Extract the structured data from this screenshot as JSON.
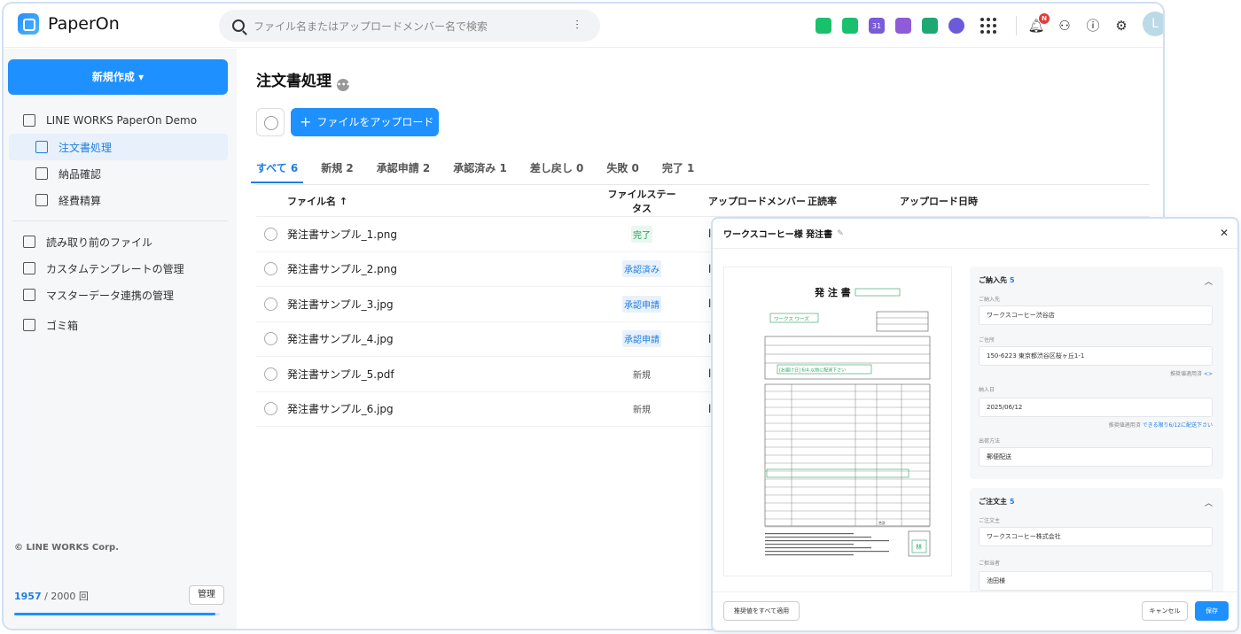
{
  "app": {
    "name": "PaperOn",
    "avatar_letter": "L"
  },
  "search": {
    "placeholder": "ファイル名またはアップロードメンバー名で検索"
  },
  "header_apps": [
    {
      "icon": "message-icon",
      "color": "#19c16c"
    },
    {
      "icon": "mail-icon",
      "color": "#19c16c"
    },
    {
      "icon": "calendar-icon",
      "color": "#7a5bd8"
    },
    {
      "icon": "note-icon",
      "color": "#8f5bd8"
    },
    {
      "icon": "drive-icon",
      "color": "#1ea872"
    },
    {
      "icon": "task-icon",
      "color": "#6b5bd8"
    }
  ],
  "notifications": {
    "badge": "N"
  },
  "calendar_day": "31",
  "sidebar": {
    "new_button": "新規作成 ▾",
    "org": "LINE WORKS PaperOn Demo",
    "workflows": [
      "注文書処理",
      "納品確認",
      "経費精算"
    ],
    "active_index": 0,
    "tools": [
      "読み取り前のファイル",
      "カスタムテンプレートの管理",
      "マスターデータ連携の管理",
      "ゴミ箱"
    ],
    "copyright": "© LINE WORKS Corp.",
    "quota_used": "1957",
    "quota_total": " / 2000 回",
    "quota_fraction": 0.9785,
    "admin_button": "管理"
  },
  "main": {
    "title": "注文書処理",
    "upload_button": "ファイルをアップロード",
    "tabs": [
      "すべて 6",
      "新規 2",
      "承認申請 2",
      "承認済み 1",
      "差し戻し 0",
      "失敗 0",
      "完了 1"
    ],
    "columns": {
      "name": "ファイル名 ↑",
      "status": "ファイルステータス",
      "uploader": "アップロードメンバー",
      "rate": "正読率",
      "date": "アップロード日時"
    },
    "rows": [
      {
        "name": "発注書サンプル_1.png",
        "status": "完了",
        "status_type": "done",
        "uploader": "la"
      },
      {
        "name": "発注書サンプル_2.png",
        "status": "承認済み",
        "status_type": "approved",
        "uploader": "la"
      },
      {
        "name": "発注書サンプル_3.jpg",
        "status": "承認申請",
        "status_type": "req",
        "uploader": "la"
      },
      {
        "name": "発注書サンプル_4.jpg",
        "status": "承認申請",
        "status_type": "req",
        "uploader": "la"
      },
      {
        "name": "発注書サンプル_5.pdf",
        "status": "新規",
        "status_type": "new",
        "uploader": "la"
      },
      {
        "name": "発注書サンプル_6.jpg",
        "status": "新規",
        "status_type": "new",
        "uploader": "la"
      }
    ]
  },
  "modal": {
    "title": "ワークスコーヒー様 発注書",
    "edit_icon": "✎",
    "doc_title": "発 注 書",
    "doc_customer": "ワークス ワーズ",
    "doc_note": "[お届け日] 6/4 以前に配達下さい",
    "doc_total_label": "合計",
    "doc_seal": "林",
    "section1": {
      "title": "ご納入先",
      "count": "5",
      "fields": [
        {
          "label": "ご納入先",
          "value": "ワークスコーヒー渋谷店"
        },
        {
          "label": "ご住所",
          "value": "150-6223 東京都渋谷区桜ヶ丘1-1"
        },
        {
          "label": "納入日",
          "value": "2025/06/12"
        },
        {
          "label": "出荷方法",
          "value": "郵便配送"
        }
      ],
      "hint1_prefix": "推奨値適用済",
      "hint1_link": "<>",
      "hint2_prefix": "推奨値適用済",
      "hint2_link": "できる限り6/12に配送下さい"
    },
    "section2": {
      "title": "ご注文主",
      "count": "5",
      "fields": [
        {
          "label": "ご注文主",
          "value": "ワークスコーヒー株式会社"
        },
        {
          "label": "ご担当者",
          "value": "池田様"
        }
      ]
    },
    "apply_all": "推奨値をすべて適用",
    "cancel": "キャンセル",
    "save": "保存"
  }
}
